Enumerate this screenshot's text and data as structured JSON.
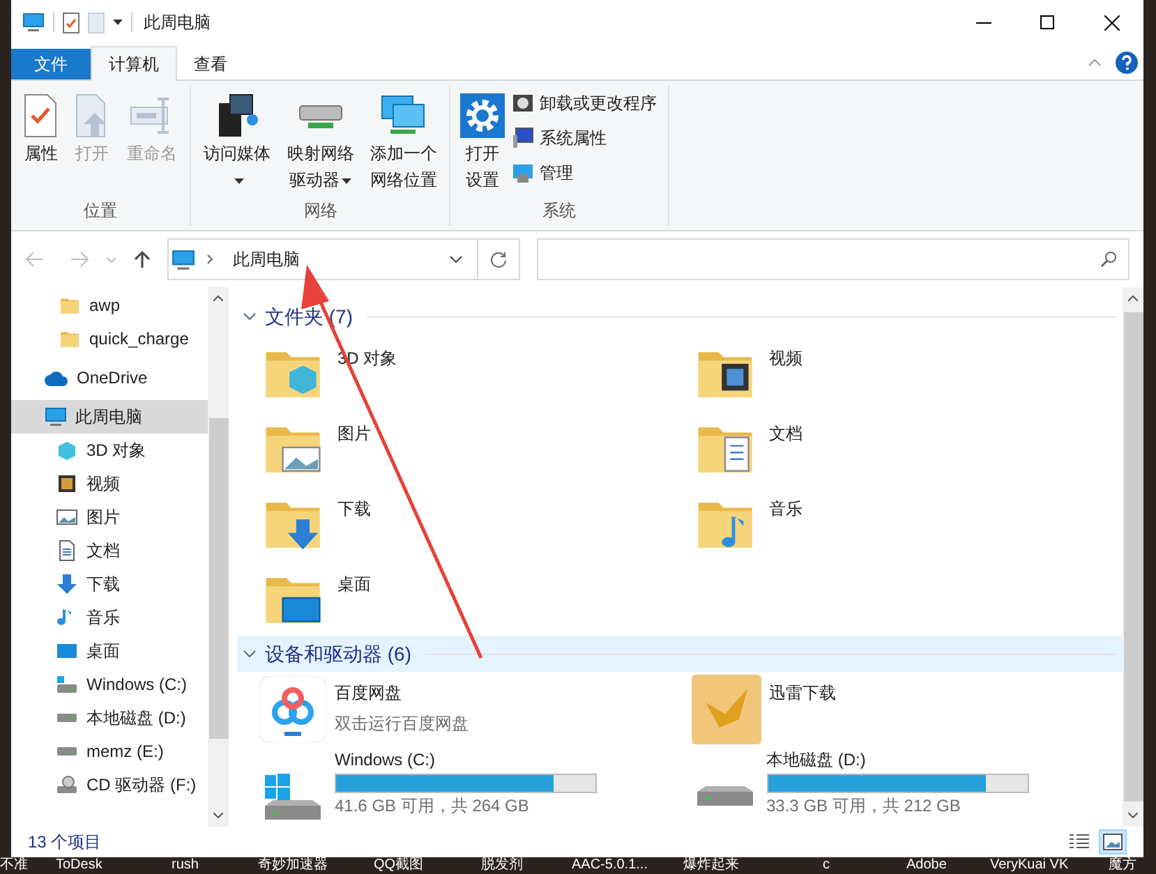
{
  "title_bar": {
    "title": "此周电脑"
  },
  "ribbon_tabs": [
    {
      "label": "文件",
      "kind": "file",
      "selected": false
    },
    {
      "label": "计算机",
      "kind": "tab",
      "selected": true
    },
    {
      "label": "查看",
      "kind": "tab",
      "selected": false
    }
  ],
  "ribbon_groups": [
    {
      "label": "位置",
      "buttons": [
        {
          "label": "属性",
          "kind": "large",
          "disabled": false,
          "has_menu": false
        },
        {
          "label": "打开",
          "kind": "large",
          "disabled": true,
          "has_menu": false
        },
        {
          "label": "重命名",
          "kind": "large",
          "disabled": true,
          "has_menu": false
        }
      ]
    },
    {
      "label": "网络",
      "buttons": [
        {
          "label": "访问媒体",
          "kind": "large",
          "disabled": false,
          "has_menu": true
        },
        {
          "label": "映射网络驱动器",
          "kind": "large",
          "disabled": false,
          "has_menu": true
        },
        {
          "label": "添加一个网络位置",
          "kind": "large",
          "disabled": false,
          "has_menu": false
        }
      ]
    },
    {
      "label": "系统",
      "buttons": [
        {
          "label": "打开设置",
          "kind": "large",
          "disabled": false,
          "has_menu": false
        },
        {
          "label": "卸载或更改程序",
          "kind": "small",
          "disabled": false,
          "has_menu": false
        },
        {
          "label": "系统属性",
          "kind": "small",
          "disabled": false,
          "has_menu": false
        },
        {
          "label": "管理",
          "kind": "small",
          "disabled": false,
          "has_menu": false
        }
      ]
    }
  ],
  "address_bar": {
    "path": "此周电脑"
  },
  "sidebar": {
    "pinned": [
      {
        "label": "awp",
        "selected": false
      },
      {
        "label": "quick_charge",
        "selected": false
      }
    ],
    "items": [
      {
        "label": "OneDrive",
        "selected": false
      },
      {
        "label": "此周电脑",
        "selected": true,
        "children": [
          {
            "label": "3D 对象",
            "selected": false
          },
          {
            "label": "视频",
            "selected": false
          },
          {
            "label": "图片",
            "selected": false
          },
          {
            "label": "文档",
            "selected": false
          },
          {
            "label": "下载",
            "selected": false
          },
          {
            "label": "音乐",
            "selected": false
          },
          {
            "label": "桌面",
            "selected": false
          },
          {
            "label": "Windows (C:)",
            "selected": false
          },
          {
            "label": "本地磁盘 (D:)",
            "selected": false
          },
          {
            "label": "memz (E:)",
            "selected": false
          },
          {
            "label": "CD 驱动器 (F:)",
            "selected": false
          }
        ]
      }
    ]
  },
  "sections": [
    {
      "title": "文件夹 (7)",
      "expanded": true,
      "hovered": false,
      "items": [
        {
          "kind": "folder",
          "name": "3D 对象"
        },
        {
          "kind": "folder",
          "name": "视频"
        },
        {
          "kind": "folder",
          "name": "图片"
        },
        {
          "kind": "folder",
          "name": "文档"
        },
        {
          "kind": "folder",
          "name": "下载"
        },
        {
          "kind": "folder",
          "name": "音乐"
        },
        {
          "kind": "folder",
          "name": "桌面"
        }
      ]
    },
    {
      "title": "设备和驱动器 (6)",
      "expanded": true,
      "hovered": true,
      "items": [
        {
          "kind": "app",
          "name": "百度网盘",
          "subtitle": "双击运行百度网盘"
        },
        {
          "kind": "app",
          "name": "迅雷下载"
        },
        {
          "kind": "drive",
          "name": "Windows (C:)",
          "level": 0.84,
          "reading": "41.6 GB 可用，共 264 GB"
        },
        {
          "kind": "drive",
          "name": "本地磁盘 (D:)",
          "level": 0.84,
          "reading": "33.3 GB 可用，共 212 GB"
        }
      ]
    }
  ],
  "status_bar": {
    "count": "13 个项目",
    "views": [
      {
        "kind": "details",
        "selected": false
      },
      {
        "kind": "large_icons",
        "selected": true
      }
    ]
  },
  "desktop_labels": [
    "不准",
    "ToDesk",
    "rush",
    "奇妙加速器",
    "QQ截图",
    "脱发剂",
    "AAC-5.0.1...",
    "爆炸起来",
    "c",
    "Adobe",
    "VeryKuai VK",
    "魔方"
  ]
}
